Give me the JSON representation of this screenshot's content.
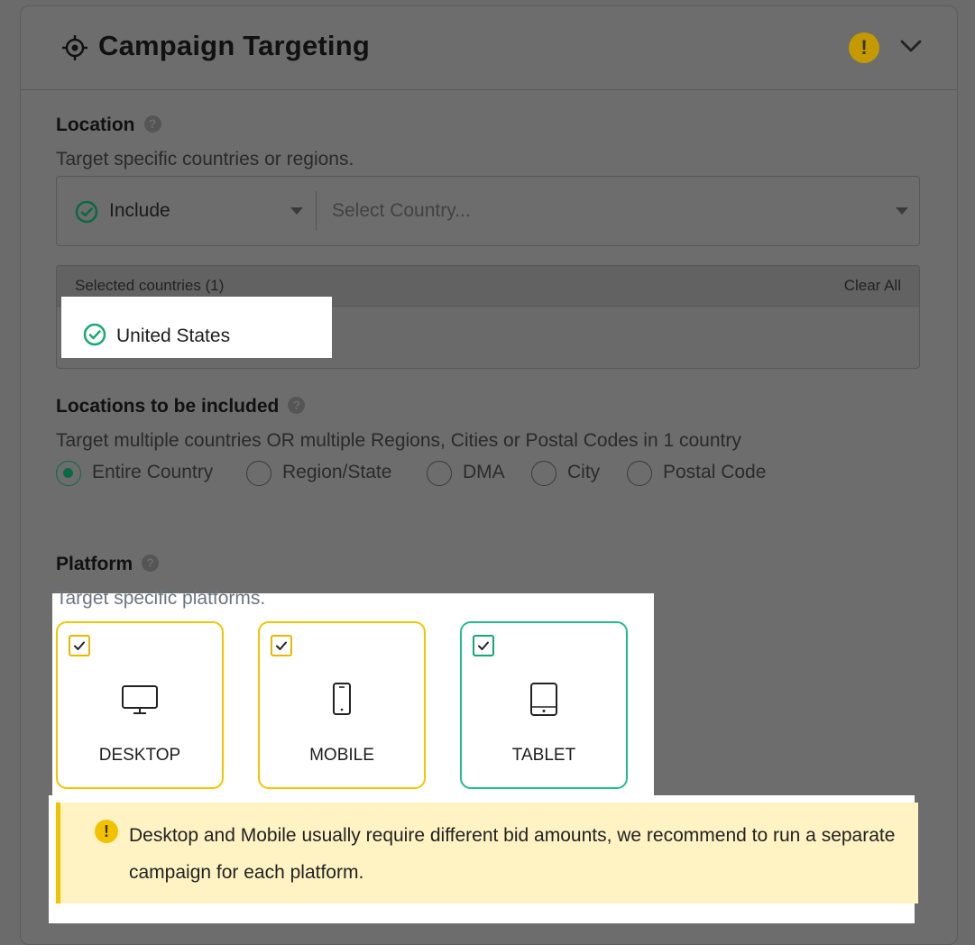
{
  "header": {
    "title": "Campaign Targeting",
    "warning_badge": "!"
  },
  "location": {
    "label": "Location",
    "help": "?",
    "description": "Target specific countries or regions.",
    "include_label": "Include",
    "country_placeholder": "Select Country...",
    "selected_title": "Selected countries (1)",
    "clear_all": "Clear All",
    "selected_items": [
      "United States"
    ]
  },
  "included": {
    "label": "Locations to be included",
    "help": "?",
    "description": "Target multiple countries OR multiple Regions, Cities or Postal Codes in 1 country",
    "options": [
      "Entire Country",
      "Region/State",
      "DMA",
      "City",
      "Postal Code"
    ],
    "selected": "Entire Country"
  },
  "platform": {
    "label": "Platform",
    "help": "?",
    "description": "Target specific platforms.",
    "items": [
      {
        "label": "DESKTOP",
        "checked": true,
        "state_color": "#f5c400"
      },
      {
        "label": "MOBILE",
        "checked": true,
        "state_color": "#f5c400"
      },
      {
        "label": "TABLET",
        "checked": true,
        "state_color": "#1fbf8a"
      }
    ],
    "warning_icon": "!",
    "warning_text": "Desktop and Mobile usually require different bid amounts, we recommend to run a separate campaign for each platform."
  }
}
